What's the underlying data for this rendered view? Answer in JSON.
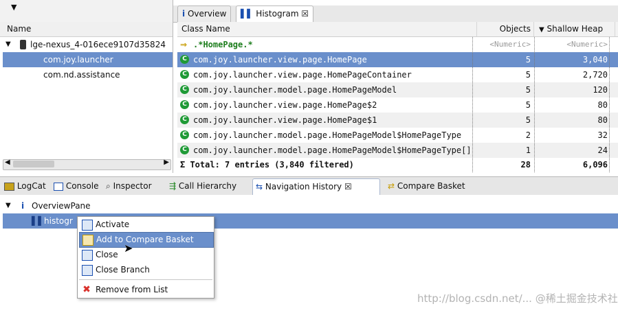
{
  "left": {
    "column_header": "Name",
    "device": "lge-nexus_4-016ece9107d35824",
    "items": [
      "com.joy.launcher",
      "com.nd.assistance"
    ]
  },
  "right_tabs": [
    {
      "label": "Overview",
      "icon": "info-icon"
    },
    {
      "label": "Histogram",
      "icon": "histogram-icon",
      "close": "☒"
    }
  ],
  "grid": {
    "headers": {
      "class_name": "Class Name",
      "objects": "Objects",
      "shallow": "Shallow Heap"
    },
    "filter": {
      "pattern": ".*HomePage.*",
      "objects": "<Numeric>",
      "shallow": "<Numeric>"
    },
    "rows": [
      {
        "name": "com.joy.launcher.view.page.HomePage",
        "objects": "5",
        "shallow": "3,040"
      },
      {
        "name": "com.joy.launcher.view.page.HomePageContainer",
        "objects": "5",
        "shallow": "2,720"
      },
      {
        "name": "com.joy.launcher.model.page.HomePageModel",
        "objects": "5",
        "shallow": "120"
      },
      {
        "name": "com.joy.launcher.view.page.HomePage$2",
        "objects": "5",
        "shallow": "80"
      },
      {
        "name": "com.joy.launcher.view.page.HomePage$1",
        "objects": "5",
        "shallow": "80"
      },
      {
        "name": "com.joy.launcher.model.page.HomePageModel$HomePageType",
        "objects": "2",
        "shallow": "32"
      },
      {
        "name": "com.joy.launcher.model.page.HomePageModel$HomePageType[]",
        "objects": "1",
        "shallow": "24"
      }
    ],
    "total": {
      "label": "Σ Total: 7 entries (3,840 filtered)",
      "objects": "28",
      "shallow": "6,096"
    }
  },
  "bottom_tabs": [
    {
      "label": "LogCat",
      "icon": "logcat-icon"
    },
    {
      "label": "Console",
      "icon": "console-icon"
    },
    {
      "label": "Inspector",
      "icon": "inspector-icon"
    },
    {
      "label": "Call Hierarchy",
      "icon": "call-hierarchy-icon"
    },
    {
      "label": "Navigation History",
      "icon": "navigation-history-icon",
      "close": "☒"
    },
    {
      "label": "Compare Basket",
      "icon": "compare-basket-icon"
    }
  ],
  "history": {
    "root": "OverviewPane",
    "child": "histogr"
  },
  "context_menu": [
    {
      "label": "Activate",
      "icon": "activate-icon"
    },
    {
      "label": "Add to Compare Basket",
      "icon": "compare-basket-icon"
    },
    {
      "label": "Close",
      "icon": "close-doc-icon"
    },
    {
      "label": "Close Branch",
      "icon": "close-branch-icon"
    },
    {
      "label": "Remove from List",
      "icon": "remove-icon"
    }
  ],
  "watermark": "http://blog.csdn.net/... @稀土掘金技术社区",
  "colors": {
    "selection": "#6a8fcb",
    "class_icon": "#1f9a36",
    "remove": "#d9312b"
  }
}
